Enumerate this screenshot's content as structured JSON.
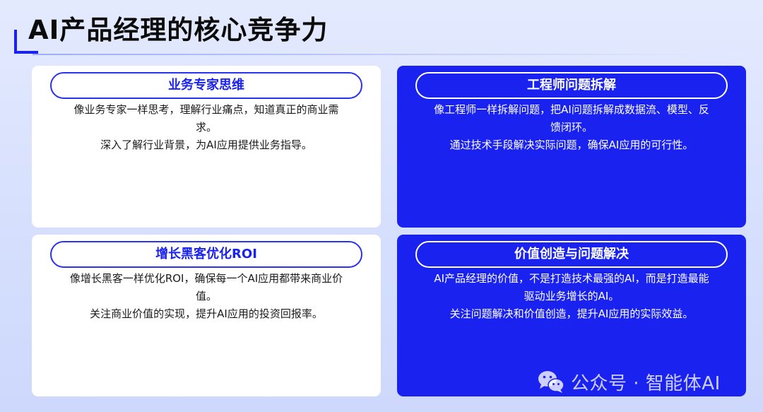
{
  "slide": {
    "title": "AI产品经理的核心竞争力"
  },
  "cards": [
    {
      "title": "业务专家思维",
      "body": [
        "像业务专家一样思考，理解行业痛点，知道真正的商业需",
        "求。",
        "深入了解行业背景，为AI应用提供业务指导。"
      ]
    },
    {
      "title": "工程师问题拆解",
      "body": [
        "像工程师一样拆解问题，把AI问题拆解成数据流、模型、反",
        "馈闭环。",
        "通过技术手段解决实际问题，确保AI应用的可行性。"
      ]
    },
    {
      "title": "增长黑客优化ROI",
      "body": [
        "像增长黑客一样优化ROI，确保每一个AI应用都带来商业价",
        "值。",
        "关注商业价值的实现，提升AI应用的投资回报率。"
      ]
    },
    {
      "title": "价值创造与问题解决",
      "body": [
        "AI产品经理的价值，不是打造技术最强的AI，而是打造最能",
        "驱动业务增长的AI。",
        "关注问题解决和价值创造，提升AI应用的实际效益。"
      ]
    }
  ],
  "watermark": {
    "text": "公众号 · 智能体AI",
    "icon": "wechat-icon"
  },
  "colors": {
    "accent_blue": "#1a22f0",
    "card_white": "#ffffff",
    "background": "#dbe3fd",
    "title_text": "#0b0b0b"
  }
}
